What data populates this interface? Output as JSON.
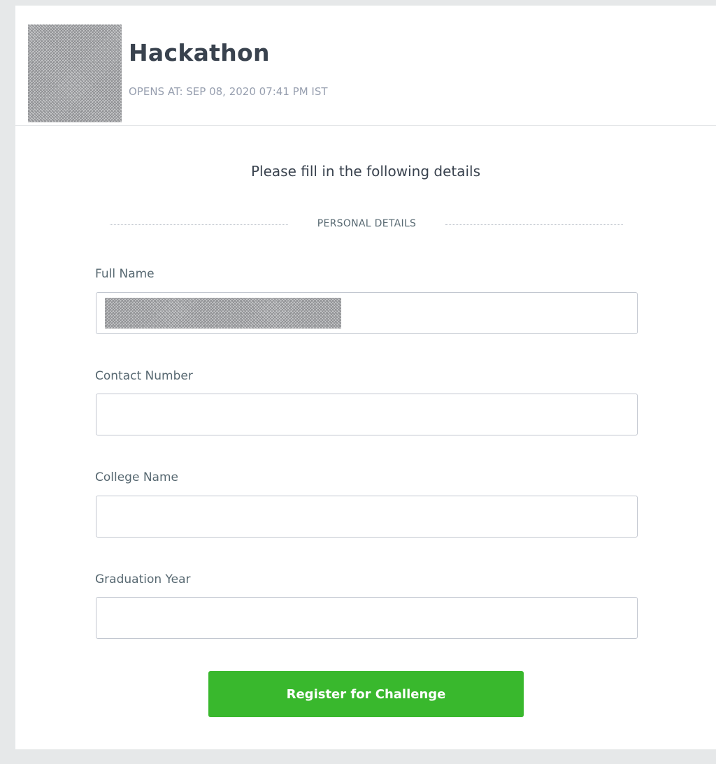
{
  "header": {
    "title": "Hackathon",
    "opens_at": "OPENS AT: SEP 08, 2020 07:41 PM IST"
  },
  "form": {
    "intro": "Please fill in the following details",
    "section_title": "PERSONAL DETAILS",
    "fields": [
      {
        "label": "Full Name",
        "value": "",
        "redacted": true
      },
      {
        "label": "Contact Number",
        "value": ""
      },
      {
        "label": "College Name",
        "value": ""
      },
      {
        "label": "Graduation Year",
        "value": ""
      }
    ],
    "submit_label": "Register for Challenge"
  },
  "colors": {
    "primary_button": "#39b82d",
    "page_background": "#e6e8e9",
    "title_text": "#39424e",
    "muted_text": "#979faf"
  }
}
